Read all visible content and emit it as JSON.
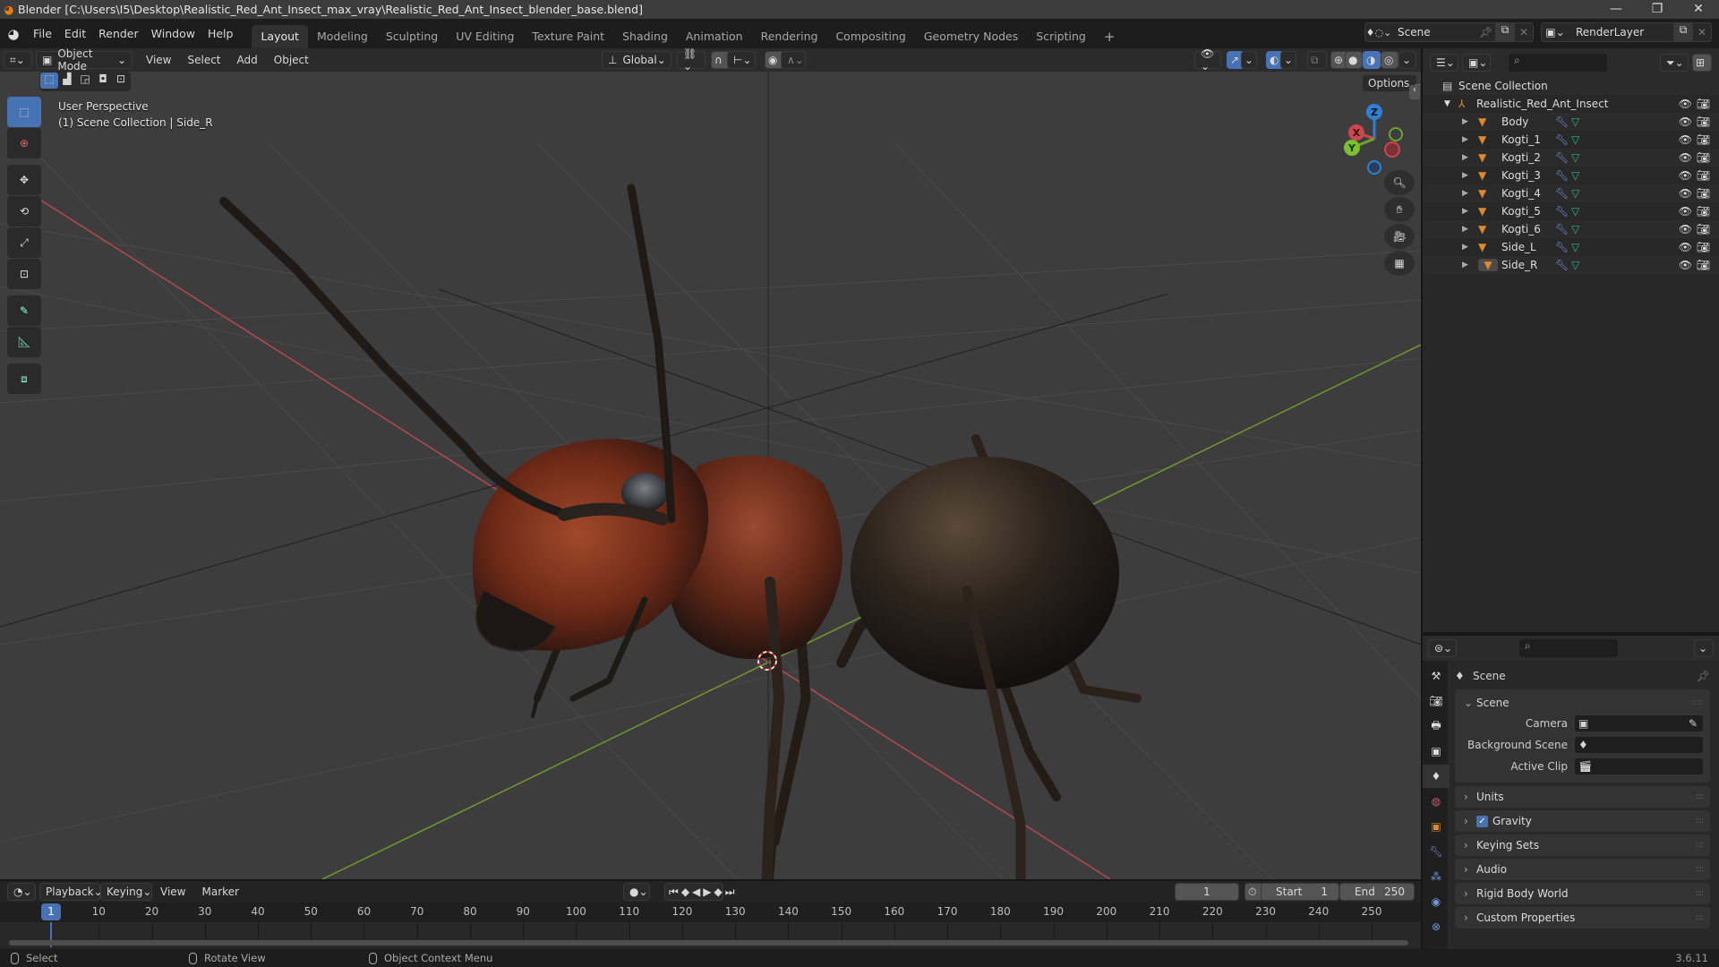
{
  "window": {
    "title": "Blender [C:\\Users\\I5\\Desktop\\Realistic_Red_Ant_Insect_max_vray\\Realistic_Red_Ant_Insect_blender_base.blend]",
    "controls": [
      "minimize",
      "maximize",
      "close"
    ]
  },
  "menubar": {
    "items": [
      "File",
      "Edit",
      "Render",
      "Window",
      "Help"
    ]
  },
  "workspaces": {
    "tabs": [
      "Layout",
      "Modeling",
      "Sculpting",
      "UV Editing",
      "Texture Paint",
      "Shading",
      "Animation",
      "Rendering",
      "Compositing",
      "Geometry Nodes",
      "Scripting"
    ],
    "active": "Layout",
    "add_label": "+"
  },
  "scene_selector": {
    "value": "Scene"
  },
  "view_layer_selector": {
    "value": "RenderLayer"
  },
  "viewport_header": {
    "mode": "Object Mode",
    "menus": [
      "View",
      "Select",
      "Add",
      "Object"
    ],
    "transform_orientation": "Global",
    "options_label": "Options"
  },
  "viewport": {
    "view_name": "User Perspective",
    "collection_info": "(1) Scene Collection | Side_R",
    "gizmo_axes": [
      "X",
      "Y",
      "Z"
    ],
    "colors": {
      "x_axis": "#c9484d",
      "y_axis": "#6ea32e",
      "z_axis": "#2f7fd7",
      "background": "#3d3d3d",
      "grid": "#505050"
    }
  },
  "tools": [
    "select-box",
    "cursor",
    "move",
    "rotate",
    "scale",
    "transform",
    "annotate",
    "measure",
    "add-cube"
  ],
  "nav_buttons": [
    "zoom",
    "pan",
    "camera-view",
    "orthographic-toggle"
  ],
  "outliner": {
    "root": "Scene Collection",
    "collection": "Realistic_Red_Ant_Insect",
    "objects": [
      {
        "name": "Body"
      },
      {
        "name": "Kogti_1"
      },
      {
        "name": "Kogti_2"
      },
      {
        "name": "Kogti_3"
      },
      {
        "name": "Kogti_4"
      },
      {
        "name": "Kogti_5"
      },
      {
        "name": "Kogti_6"
      },
      {
        "name": "Side_L"
      },
      {
        "name": "Side_R",
        "active": true
      }
    ]
  },
  "properties": {
    "context_title": "Scene",
    "scene_panel": {
      "title": "Scene",
      "fields": [
        {
          "label": "Camera",
          "value": ""
        },
        {
          "label": "Background Scene",
          "value": ""
        },
        {
          "label": "Active Clip",
          "value": ""
        }
      ]
    },
    "collapsed_panels": [
      {
        "title": "Units"
      },
      {
        "title": "Gravity",
        "checkbox": true,
        "checked": true
      },
      {
        "title": "Keying Sets"
      },
      {
        "title": "Audio"
      },
      {
        "title": "Rigid Body World"
      },
      {
        "title": "Custom Properties"
      }
    ],
    "tabs": [
      "tool",
      "render",
      "output",
      "view-layer",
      "scene",
      "world",
      "object",
      "modifiers",
      "particles",
      "physics",
      "constraints"
    ],
    "active_tab": "scene"
  },
  "timeline": {
    "menus": [
      "Playback",
      "Keying",
      "View",
      "Marker"
    ],
    "current_frame": "1",
    "start_label": "Start",
    "start": "1",
    "end_label": "End",
    "end": "250",
    "ruler": [
      "10",
      "20",
      "30",
      "40",
      "50",
      "60",
      "70",
      "80",
      "90",
      "100",
      "110",
      "120",
      "130",
      "140",
      "150",
      "160",
      "170",
      "180",
      "190",
      "200",
      "210",
      "220",
      "230",
      "240",
      "250"
    ],
    "playhead_label": "1"
  },
  "statusbar": {
    "hints": [
      "Select",
      "Rotate View",
      "Object Context Menu"
    ],
    "version": "3.6.11"
  }
}
